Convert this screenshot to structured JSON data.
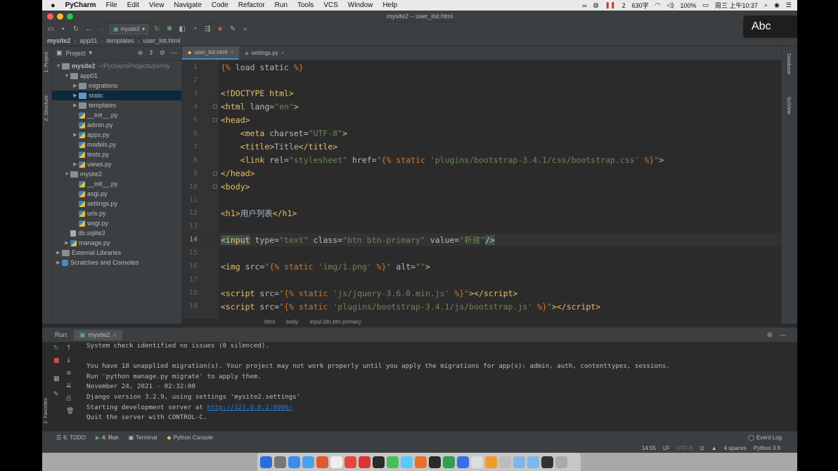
{
  "menubar": {
    "app": "PyCharm",
    "items": [
      "File",
      "Edit",
      "View",
      "Navigate",
      "Code",
      "Refactor",
      "Run",
      "Tools",
      "VCS",
      "Window",
      "Help"
    ],
    "status_count": "2",
    "chars": "630字",
    "battery": "100%",
    "clock": "周三 上午10:37"
  },
  "window": {
    "title": "mysite2 – user_list.html",
    "run_config": "mysite2"
  },
  "breadcrumb": [
    "mysite2",
    "app01",
    "templates",
    "user_list.html"
  ],
  "project": {
    "header": "Project",
    "tree": [
      {
        "name": "mysite2",
        "extra": "~/PycharmProjects/px/my",
        "indent": 0,
        "arrow": "▼",
        "icon": "folder",
        "bold": true
      },
      {
        "name": "app01",
        "indent": 1,
        "arrow": "▼",
        "icon": "folder"
      },
      {
        "name": "migrations",
        "indent": 2,
        "arrow": "▶",
        "icon": "folder"
      },
      {
        "name": "static",
        "indent": 2,
        "arrow": "▶",
        "icon": "folder-blue",
        "selected": true
      },
      {
        "name": "templates",
        "indent": 2,
        "arrow": "▶",
        "icon": "folder"
      },
      {
        "name": "__init__.py",
        "indent": 2,
        "arrow": "",
        "icon": "py"
      },
      {
        "name": "admin.py",
        "indent": 2,
        "arrow": "",
        "icon": "py"
      },
      {
        "name": "apps.py",
        "indent": 2,
        "arrow": "▶",
        "icon": "py"
      },
      {
        "name": "models.py",
        "indent": 2,
        "arrow": "",
        "icon": "py"
      },
      {
        "name": "tests.py",
        "indent": 2,
        "arrow": "",
        "icon": "py"
      },
      {
        "name": "views.py",
        "indent": 2,
        "arrow": "▶",
        "icon": "py"
      },
      {
        "name": "mysite2",
        "indent": 1,
        "arrow": "▼",
        "icon": "folder"
      },
      {
        "name": "__init__.py",
        "indent": 2,
        "arrow": "",
        "icon": "py"
      },
      {
        "name": "asgi.py",
        "indent": 2,
        "arrow": "",
        "icon": "py"
      },
      {
        "name": "settings.py",
        "indent": 2,
        "arrow": "",
        "icon": "py"
      },
      {
        "name": "urls.py",
        "indent": 2,
        "arrow": "",
        "icon": "py"
      },
      {
        "name": "wsgi.py",
        "indent": 2,
        "arrow": "",
        "icon": "py"
      },
      {
        "name": "db.sqlite3",
        "indent": 1,
        "arrow": "",
        "icon": "db"
      },
      {
        "name": "manage.py",
        "indent": 1,
        "arrow": "▶",
        "icon": "py"
      },
      {
        "name": "External Libraries",
        "indent": 0,
        "arrow": "▶",
        "icon": "lib"
      },
      {
        "name": "Scratches and Consoles",
        "indent": 0,
        "arrow": "▶",
        "icon": "scratch"
      }
    ]
  },
  "editor": {
    "tabs": [
      {
        "label": "user_list.html",
        "active": true
      },
      {
        "label": "settings.py",
        "active": false
      }
    ],
    "current_line": 14,
    "lines": [
      {
        "n": "1",
        "html": "<span class='t-tpl'>{%</span> <span class='t-txt'>load static</span> <span class='t-tpl'>%}</span>"
      },
      {
        "n": "2",
        "html": ""
      },
      {
        "n": "3",
        "html": "<span class='t-doc'>&lt;!DOCTYPE html&gt;</span>"
      },
      {
        "n": "4",
        "html": "<span class='t-tag'>&lt;html </span><span class='t-attr'>lang=</span><span class='t-str'>\"en\"</span><span class='t-tag'>&gt;</span>"
      },
      {
        "n": "5",
        "html": "<span class='t-tag'>&lt;head&gt;</span>"
      },
      {
        "n": "6",
        "html": "    <span class='t-tag'>&lt;meta </span><span class='t-attr'>charset=</span><span class='t-str'>\"UTF-8\"</span><span class='t-tag'>&gt;</span>"
      },
      {
        "n": "7",
        "html": "    <span class='t-tag'>&lt;title&gt;</span><span class='t-txt'>Title</span><span class='t-tag'>&lt;/title&gt;</span>"
      },
      {
        "n": "8",
        "html": "    <span class='t-tag'>&lt;link </span><span class='t-attr'>rel=</span><span class='t-str'>\"stylesheet\"</span> <span class='t-attr'>href=</span><span class='t-str'>\"</span><span class='t-tpl'>{%</span> <span class='t-tpl'>static</span> <span class='t-tplstr'>'plugins/bootstrap-3.4.1/css/bootstrap.css'</span> <span class='t-tpl'>%}</span><span class='t-str'>\"</span><span class='t-tag'>&gt;</span>"
      },
      {
        "n": "9",
        "html": "<span class='t-tag'>&lt;/head&gt;</span>"
      },
      {
        "n": "10",
        "html": "<span class='t-tag'>&lt;body&gt;</span>"
      },
      {
        "n": "11",
        "html": ""
      },
      {
        "n": "12",
        "html": "<span class='t-tag'>&lt;h1&gt;</span><span class='t-txt'>用户列表</span><span class='t-tag'>&lt;/h1&gt;</span>"
      },
      {
        "n": "13",
        "html": ""
      },
      {
        "n": "14",
        "html": "<span class='t-hl'>&lt;input</span> <span class='t-attr'>type=</span><span class='t-str'>\"text\"</span> <span class='t-attr'>class=</span><span class='t-str'>\"btn btn-primary\"</span> <span class='t-attr'>value=</span><span class='t-str'>\"新建\"</span><span class='t-hl'>/&gt;</span>"
      },
      {
        "n": "15",
        "html": ""
      },
      {
        "n": "16",
        "html": "<span class='t-tag'>&lt;img </span><span class='t-attr'>src=</span><span class='t-str'>\"</span><span class='t-tpl'>{%</span> <span class='t-tpl'>static</span> <span class='t-tplstr'>'img/1.png'</span> <span class='t-tpl'>%}</span><span class='t-str'>\"</span> <span class='t-attr'>alt=</span><span class='t-str'>\"\"</span><span class='t-tag'>&gt;</span>"
      },
      {
        "n": "17",
        "html": ""
      },
      {
        "n": "18",
        "html": "<span class='t-tag'>&lt;script </span><span class='t-attr'>src=</span><span class='t-str'>\"</span><span class='t-tpl'>{%</span> <span class='t-tpl'>static</span> <span class='t-tplstr'>'js/jquery-3.6.0.min.js'</span> <span class='t-tpl'>%}</span><span class='t-str'>\"</span><span class='t-tag'>&gt;&lt;/script&gt;</span>"
      },
      {
        "n": "19",
        "html": "<span class='t-tag'>&lt;script </span><span class='t-attr'>src=</span><span class='t-str'>\"</span><span class='t-tpl'>{%</span> <span class='t-tpl'>static</span> <span class='t-tplstr'>'plugins/bootstrap-3.4.1/js/bootstrap.js'</span> <span class='t-tpl'>%}</span><span class='t-str'>\"</span><span class='t-tag'>&gt;&lt;/script&gt;</span>"
      }
    ],
    "breadcrumb": [
      "html",
      "body",
      "input.btn.btn-primary"
    ]
  },
  "run": {
    "label": "Run:",
    "config": "mysite2",
    "console": [
      "System check identified no issues (0 silenced).",
      "",
      "You have 18 unapplied migration(s). Your project may not work properly until you apply the migrations for app(s): admin, auth, contenttypes, sessions.",
      "Run 'python manage.py migrate' to apply them.",
      "November 24, 2021 - 02:32:00",
      "Django version 3.2.9, using settings 'mysite2.settings'",
      "Starting development server at ",
      "Quit the server with CONTROL-C."
    ],
    "server_link": "http://127.0.0.1:8000/"
  },
  "bottombar": {
    "todo": "6: TODO",
    "run": "4: Run",
    "terminal": "Terminal",
    "python_console": "Python Console",
    "event_log": "Event Log"
  },
  "statusbar": {
    "position": "14:55",
    "line_sep": "LF",
    "encoding": "UTF-8",
    "indent": "4 spaces",
    "interpreter": "Python 3.9"
  },
  "side_labels": {
    "project": "1: Project",
    "structure": "Z: Structure",
    "favorites": "2: Favorites",
    "database": "Database",
    "sciview": "SciView"
  },
  "overlay": {
    "input_source": "Abc"
  },
  "colors": {
    "editor_bg": "#2b2b2b",
    "panel_bg": "#3c3f41",
    "tag": "#e8bf6a",
    "string": "#6a8759",
    "keyword": "#cc7832",
    "link": "#287bde",
    "selection": "#0d293e"
  }
}
